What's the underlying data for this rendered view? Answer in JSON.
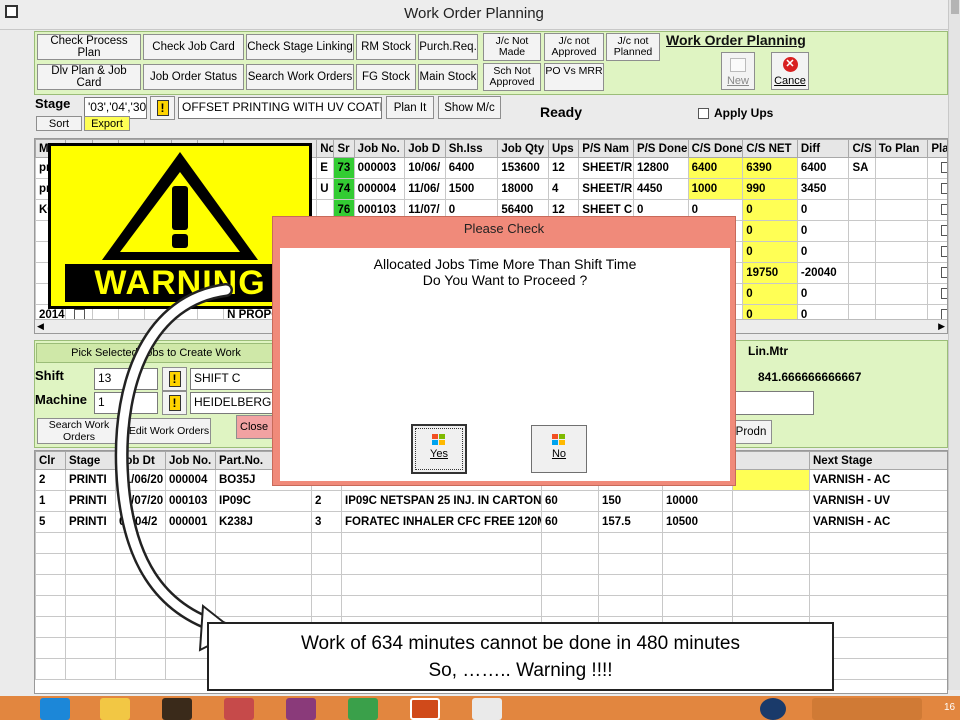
{
  "window": {
    "title": "Work Order Planning"
  },
  "toolbar": {
    "buttons_row1": [
      "Check Process Plan",
      "Check Job Card",
      "Check Stage Linking",
      "RM Stock",
      "Purch.Req."
    ],
    "buttons_row2": [
      "Dlv Plan & Job Card",
      "Job Order Status",
      "Search Work Orders",
      "FG Stock",
      "Main Stock"
    ],
    "jc_not_made": "J/c Not Made",
    "jc_not_approved": "J/c not Approved",
    "jc_not_planned": "J/c not Planned",
    "sch_not_approved": "Sch Not Approved",
    "po_vs_mrr": "PO Vs MRR",
    "heading": "Work Order Planning",
    "new_label": "New",
    "cancel_label": "Cance"
  },
  "stage": {
    "label": "Stage",
    "value": "'03','04','30",
    "description": "OFFSET PRINTING WITH UV COATING",
    "sort": "Sort",
    "export": "Export",
    "plan_it": "Plan It",
    "show_mc": "Show M/c",
    "status": "Ready",
    "apply_ups": "Apply Ups"
  },
  "upper_table": {
    "columns": [
      "Ma",
      "",
      "",
      "",
      "",
      "",
      "",
      "",
      "No",
      "Sr",
      "Job No.",
      "Job D",
      "Sh.Iss",
      "Job Qty",
      "Ups",
      "P/S Nam",
      "P/S Done",
      "C/S Done",
      "C/S NET",
      "Diff",
      "C/S",
      "To Plan",
      "Plan"
    ],
    "rows": [
      {
        "c0": "pr",
        "no": "E",
        "sr": "73",
        "job_no": "000003",
        "job_d": "10/06/",
        "sh_iss": "6400",
        "job_qty": "153600",
        "ups": "12",
        "ps_nam": "SHEET/R",
        "ps_done": "12800",
        "cs_done": "6400",
        "cs_net": "6390",
        "diff": "6400",
        "cs": "SA"
      },
      {
        "c0": "pr",
        "no": "U",
        "sr": "74",
        "job_no": "000004",
        "job_d": "11/06/",
        "sh_iss": "1500",
        "job_qty": "18000",
        "ups": "4",
        "ps_nam": "SHEET/R",
        "ps_done": "4450",
        "cs_done": "1000",
        "cs_net": "990",
        "diff": "3450",
        "cs": ""
      },
      {
        "c0": "KC",
        "no": "",
        "sr": "76",
        "job_no": "000103",
        "job_d": "11/07/",
        "sh_iss": "0",
        "job_qty": "56400",
        "ups": "12",
        "ps_nam": "SHEET C",
        "ps_done": "0",
        "cs_done": "0",
        "cs_net": "0",
        "diff": "0",
        "cs": ""
      },
      {
        "c0": "",
        "cs_net": "0",
        "diff": "0"
      },
      {
        "c0": "",
        "cs_net": "0",
        "diff": "0"
      },
      {
        "c0": "",
        "cs_net": "19750",
        "diff": "-20040"
      },
      {
        "c0": "",
        "cs_net": "0",
        "diff": "0"
      },
      {
        "c0": "2014-",
        "extra": "N PROPO",
        "cs_net": "0",
        "diff": "0"
      }
    ]
  },
  "mid": {
    "pick_label": "Pick Selected Jobs to Create Work",
    "shift_label": "Shift",
    "shift_code": "13",
    "shift_name": "SHIFT C",
    "machine_label": "Machine",
    "machine_code": "1",
    "machine_name": "HEIDELBERG",
    "search_work_orders": "Search Work Orders",
    "edit_work_orders": "Edit Work Orders",
    "close": "Close",
    "prodn": "Prodn",
    "linmtr_label": "Lin.Mtr",
    "linmtr_value": "841.666666666667"
  },
  "lower_table": {
    "columns": [
      "Clr",
      "Stage",
      "Job Dt",
      "Job No.",
      "Part.No.",
      "",
      "",
      "",
      "",
      "Next Stage"
    ],
    "rows": [
      {
        "clr": "2",
        "stage": "PRINTI",
        "job_dt": "11/06/20",
        "job_no": "000004",
        "part_no": "BO35J",
        "seq": "",
        "desc": "",
        "a": "",
        "b": "",
        "c": "",
        "next": "VARNISH - AC"
      },
      {
        "clr": "1",
        "stage": "PRINTI",
        "job_dt": "11/07/20",
        "job_no": "000103",
        "part_no": "IP09C",
        "seq": "2",
        "desc": "IP09C NETSPAN 25 INJ. IN CARTON",
        "a": "60",
        "b": "150",
        "c": "10000",
        "next": "VARNISH - UV"
      },
      {
        "clr": "5",
        "stage": "PRINTI",
        "job_dt": "02/04/2",
        "job_no": "000001",
        "part_no": "K238J",
        "seq": "3",
        "desc": "FORATEC INHALER CFC FREE 120M",
        "a": "60",
        "b": "157.5",
        "c": "10500",
        "next": "VARNISH - AC"
      }
    ]
  },
  "dialog": {
    "title": "Please Check",
    "line1": "Allocated Jobs Time More Than Shift Time",
    "line2": "Do You Want to Proceed ?",
    "yes": "Yes",
    "no": "No"
  },
  "warning": {
    "text": "WARNING"
  },
  "callout": {
    "line1": "Work of 634 minutes cannot be done in 480 minutes",
    "line2": "So, …….. Warning !!!!"
  },
  "taskbar": {
    "clock_partial": "16"
  },
  "colors": {
    "panel_green": "#dff4c2",
    "highlight_yellow": "#ffff55",
    "highlight_green": "#33cc33",
    "dialog_title": "#f08a7a",
    "warning_yellow": "#ffff00",
    "taskbar": "#e2863f",
    "close_button": "#f2a2a2"
  }
}
